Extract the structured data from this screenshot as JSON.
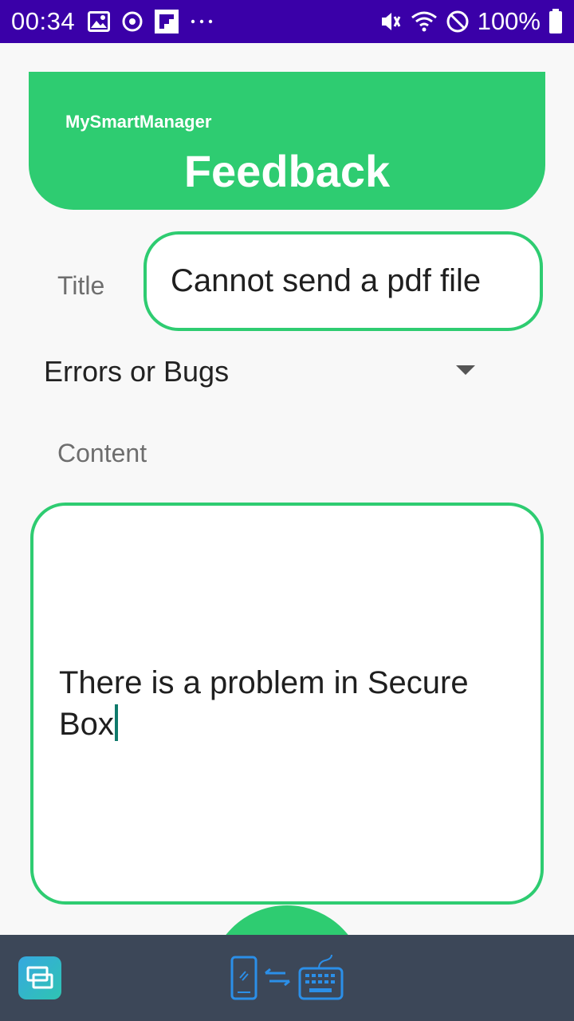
{
  "status_bar": {
    "time": "00:34",
    "battery_percent": "100%",
    "icons_left": [
      "image-icon",
      "sync-circle-icon",
      "flipboard-icon",
      "more-dots-icon"
    ],
    "icons_right": [
      "vibrate-mute-icon",
      "wifi-icon",
      "do-not-disturb-icon",
      "battery-icon"
    ],
    "background_color": "#3a00a8"
  },
  "header": {
    "app_name": "MySmartManager",
    "title": "Feedback",
    "color": "#2ecc71"
  },
  "form": {
    "title_label": "Title",
    "title_value": "Cannot send a pdf file",
    "category_value": "Errors or Bugs",
    "content_label": "Content",
    "content_value": "There is a problem in Secure Box"
  },
  "bottom_bar": {
    "app_icon": "screen-mirror-app-icon",
    "center_icon": "phone-keyboard-sync-icon",
    "background_color": "#3c4758"
  }
}
